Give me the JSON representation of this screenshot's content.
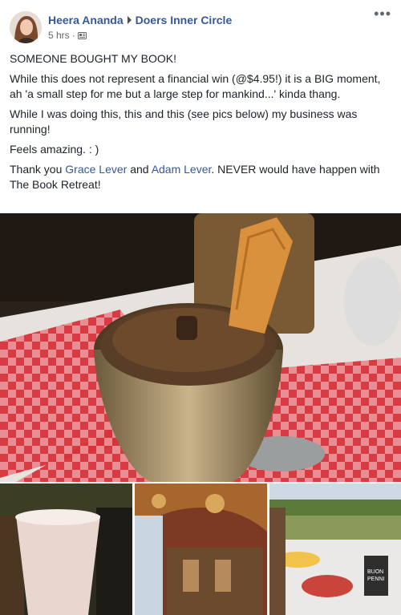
{
  "post": {
    "author": "Heera Ananda",
    "group": "Doers Inner Circle",
    "time": "5 hrs",
    "separator": "·",
    "privacy_icon": "group-privacy-icon",
    "more_icon": "more-options-icon",
    "more_label": "•••"
  },
  "body": {
    "line1": "SOMEONE BOUGHT MY BOOK!",
    "line2": "While this does not represent a financial win (@$4.95!) it is a BIG moment, ah 'a small step for me but a large step for mankind...' kinda thang.",
    "line3": "While I was doing this, this and this (see pics below) my business was running!",
    "line4": "Feels amazing. : )",
    "line5_prefix": "Thank you ",
    "line5_name1": "Grace Lever",
    "line5_and": " and ",
    "line5_name2": "Adam Lever",
    "line5_suffix": ". NEVER would have happen with The Book Retreat!"
  },
  "photos": {
    "main": "tiramisu dessert photo",
    "thumb1": "milkshake photo",
    "thumb2": "fresco chapel photo",
    "thumb3": "outdoor snack table photo",
    "thumb3_cup_text": "BUON\nPENNI"
  },
  "colors": {
    "link": "#365899",
    "text": "#1d2129",
    "meta": "#616770"
  }
}
